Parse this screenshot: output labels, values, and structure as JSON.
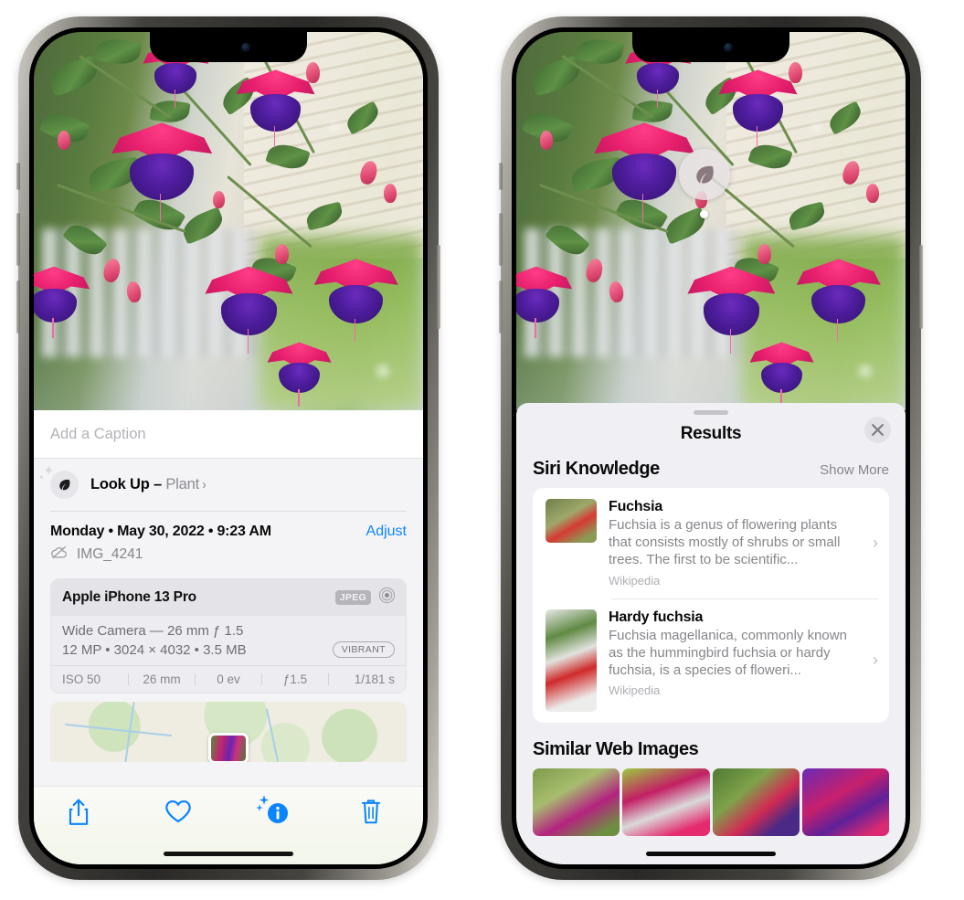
{
  "left_phone": {
    "device_name": "iPhone",
    "photo": {
      "alt": "fuchsia-flowers-photo"
    },
    "caption_field": {
      "placeholder": "Add a Caption",
      "value": ""
    },
    "lookup_row": {
      "icon": "leaf-icon",
      "label": "Look Up – ",
      "subject": "Plant",
      "chevron": "›"
    },
    "metadata": {
      "date_line": "Monday • May 30, 2022 • 9:23 AM",
      "adjust_label": "Adjust",
      "cloud_icon": "cloud-slash-icon",
      "filename": "IMG_4241"
    },
    "camera_card": {
      "device": "Apple iPhone 13 Pro",
      "format_badge": "JPEG",
      "lens_icon": "aperture-icon",
      "lens_line": "Wide Camera — 26 mm ƒ 1.5",
      "specs_line": "12 MP • 3024 × 4032 • 3.5 MB",
      "style_badge": "VIBRANT",
      "exif": [
        "ISO 50",
        "26 mm",
        "0 ev",
        "ƒ1.5",
        "1/181 s"
      ]
    },
    "map_card": {
      "name": "photo-location-map"
    },
    "toolbar": [
      {
        "name": "share-button",
        "icon": "share-icon"
      },
      {
        "name": "favorite-button",
        "icon": "heart-icon"
      },
      {
        "name": "info-button",
        "icon": "info-sparkle-icon"
      },
      {
        "name": "delete-button",
        "icon": "trash-icon"
      }
    ]
  },
  "right_phone": {
    "visual_lookup_badge": {
      "icon": "leaf-icon",
      "name": "visual-lookup-badge"
    },
    "sheet": {
      "title": "Results",
      "close_icon": "close-icon",
      "siri_knowledge": {
        "heading": "Siri Knowledge",
        "show_more": "Show More",
        "items": [
          {
            "title": "Fuchsia",
            "description": "Fuchsia is a genus of flowering plants that consists mostly of shrubs or small trees. The first to be scientific...",
            "source": "Wikipedia",
            "thumb": "fuchsia-thumbnail"
          },
          {
            "title": "Hardy fuchsia",
            "description": "Fuchsia magellanica, commonly known as the hummingbird fuchsia or hardy fuchsia, is a species of floweri...",
            "source": "Wikipedia",
            "thumb": "hardy-fuchsia-thumbnail"
          }
        ]
      },
      "similar_web_images": {
        "heading": "Similar Web Images",
        "items": [
          {
            "name": "web-image-1"
          },
          {
            "name": "web-image-2"
          },
          {
            "name": "web-image-3"
          },
          {
            "name": "web-image-4"
          }
        ]
      }
    }
  },
  "colors": {
    "accent_blue": "#0a84ff",
    "sheet_bg": "#f0eff4",
    "card_bg": "#ffffff",
    "secondary_text": "#86868b"
  }
}
